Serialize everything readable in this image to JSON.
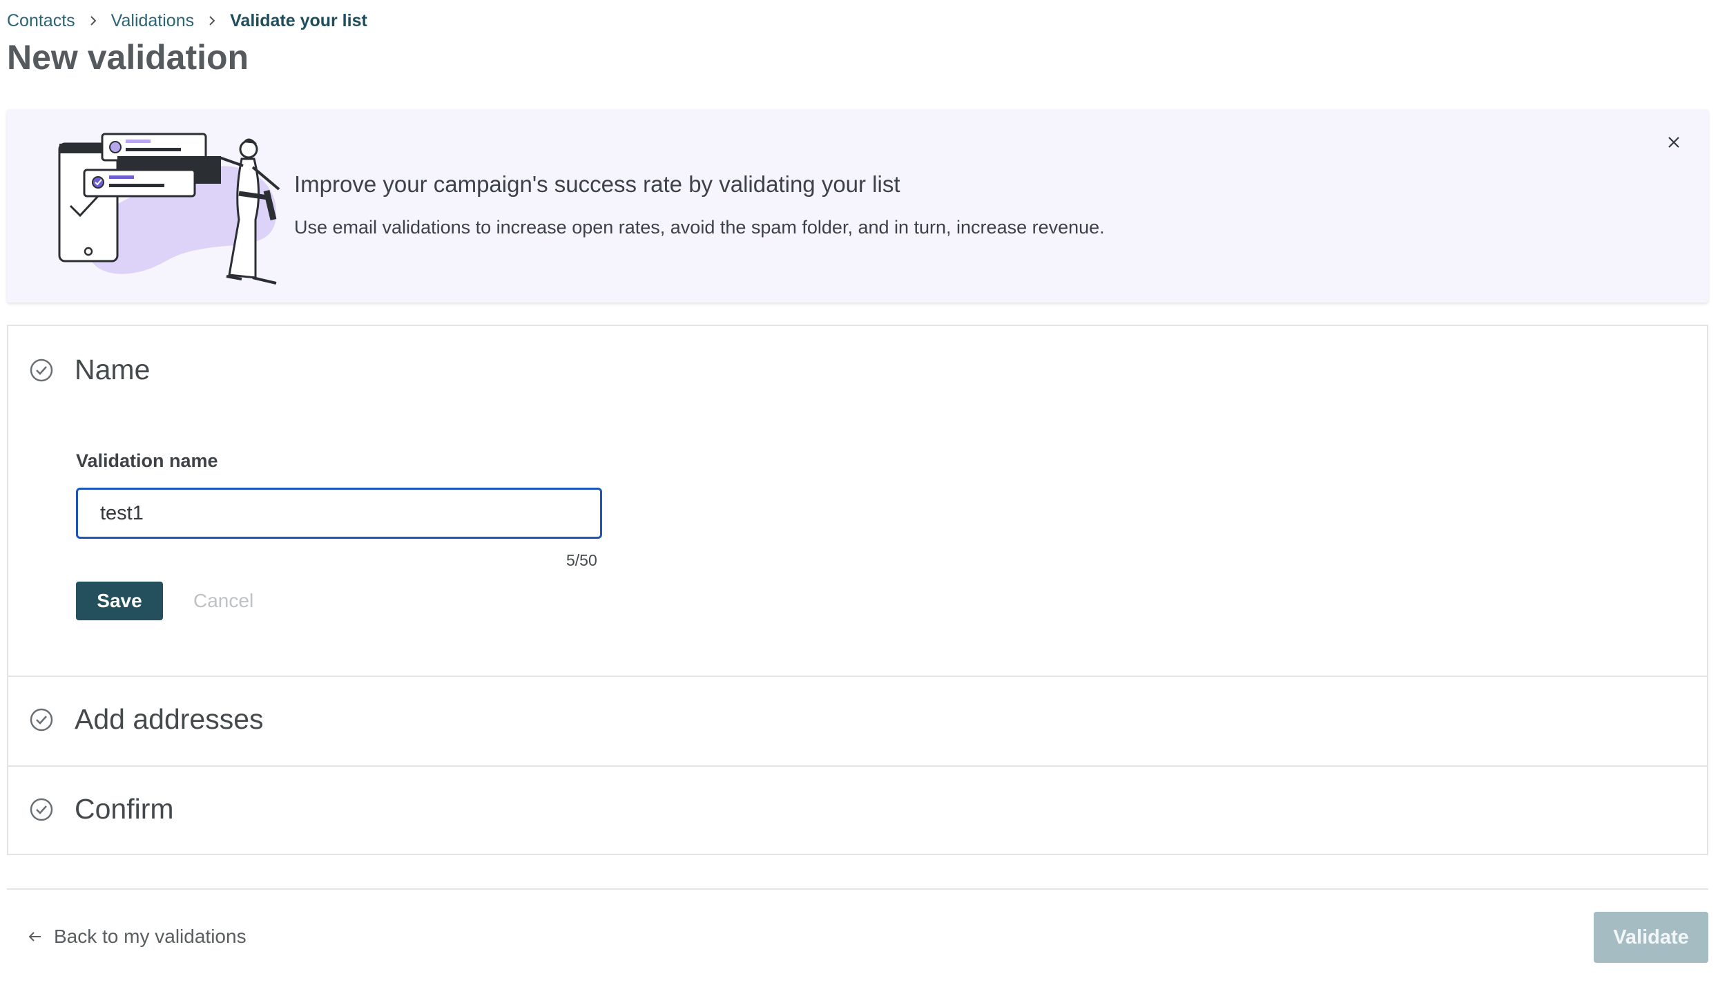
{
  "breadcrumb": {
    "items": [
      "Contacts",
      "Validations",
      "Validate your list"
    ]
  },
  "page": {
    "title": "New validation"
  },
  "banner": {
    "title": "Improve your campaign's success rate by validating your list",
    "description": "Use email validations to increase open rates, avoid the spam folder, and in turn, increase revenue."
  },
  "steps": {
    "name": {
      "title": "Name",
      "field_label": "Validation name",
      "value": "test1",
      "char_count": "5/50",
      "save_label": "Save",
      "cancel_label": "Cancel"
    },
    "add_addresses": {
      "title": "Add addresses"
    },
    "confirm": {
      "title": "Confirm"
    }
  },
  "footer": {
    "back_label": "Back to my validations",
    "validate_label": "Validate"
  },
  "colors": {
    "primary": "#24505e",
    "focus": "#1c56b8",
    "banner_bg": "#f6f4fd",
    "accent_purple": "#d9d0f7",
    "disabled": "#a6bcc3"
  },
  "icons": {
    "step": "check-circle-icon",
    "close": "close-icon",
    "back": "arrow-left-icon",
    "breadcrumb_sep": "chevron-right-icon"
  }
}
